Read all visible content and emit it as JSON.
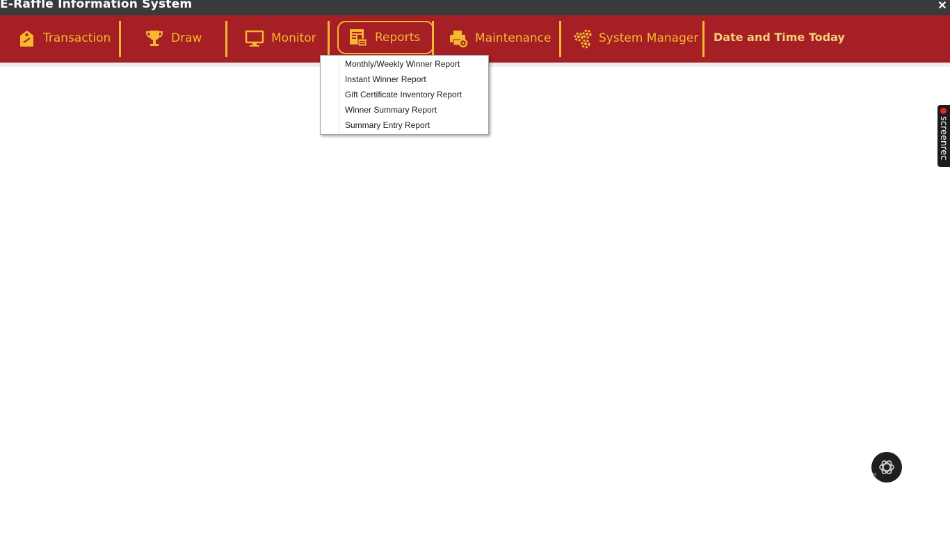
{
  "window": {
    "title": "E-Raffle Information System",
    "close_glyph": "✕"
  },
  "menubar": {
    "items": [
      {
        "label": "Transaction",
        "icon": "tag-icon"
      },
      {
        "label": "Draw",
        "icon": "trophy-icon"
      },
      {
        "label": "Monitor",
        "icon": "monitor-icon"
      },
      {
        "label": "Reports",
        "icon": "report-icon",
        "active": true
      },
      {
        "label": "Maintenance",
        "icon": "printer-gear-icon"
      },
      {
        "label": "System Manager",
        "icon": "gears-icon"
      }
    ],
    "datetime_label": "Date and Time Today"
  },
  "reports_menu": {
    "items": [
      "Monthly/Weekly Winner Report",
      "Instant Winner Report",
      "Gift Certificate Inventory Report",
      "Winner Summary Report",
      "Summary Entry Report"
    ]
  },
  "overlay": {
    "screenrec_label": "screenrec"
  },
  "colors": {
    "menubar_bg": "#a61f24",
    "accent": "#f5b82e",
    "titlebar_bg": "#3a3a3a"
  }
}
